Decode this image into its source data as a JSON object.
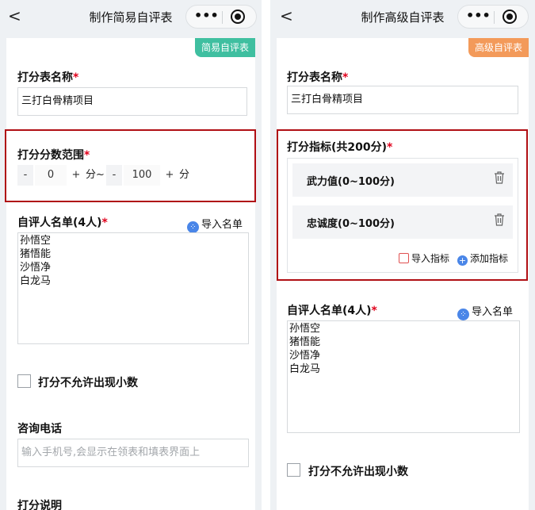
{
  "simple": {
    "nav_title": "制作简易自评表",
    "badge": "简易自评表",
    "badge_color": "#3fbfa0",
    "name_label": "打分表名称",
    "name_value": "三打白骨精项目",
    "range_label": "打分分数范围",
    "range": {
      "min_minus": "-",
      "min_value": "0",
      "min_plus": "+",
      "min_unit": "分~",
      "max_minus": "-",
      "max_value": "100",
      "max_plus": "+",
      "max_unit": "分"
    },
    "list_label": "自评人名单(4人)",
    "import_list": "导入名单",
    "names": [
      "孙悟空",
      "猪悟能",
      "沙悟净",
      "白龙马"
    ],
    "no_decimal": "打分不允许出现小数",
    "phone_label": "咨询电话",
    "phone_placeholder": "输入手机号,会显示在领表和填表界面上",
    "desc_label": "打分说明"
  },
  "advanced": {
    "nav_title": "制作高级自评表",
    "badge": "高级自评表",
    "badge_color": "#f39a5a",
    "name_label": "打分表名称",
    "name_value": "三打白骨精项目",
    "metrics_label": "打分指标(共200分)",
    "metrics": [
      {
        "name": "武力值(0~100分)"
      },
      {
        "name": "忠诚度(0~100分)"
      }
    ],
    "import_metrics": "导入指标",
    "add_metric": "添加指标",
    "list_label": "自评人名单(4人)",
    "import_list": "导入名单",
    "names": [
      "孙悟空",
      "猪悟能",
      "沙悟净",
      "白龙马"
    ],
    "no_decimal": "打分不允许出现小数"
  },
  "nav": {
    "back": "<",
    "more": "•••"
  },
  "required_mark": "*",
  "highlight_color": "#b00f14"
}
